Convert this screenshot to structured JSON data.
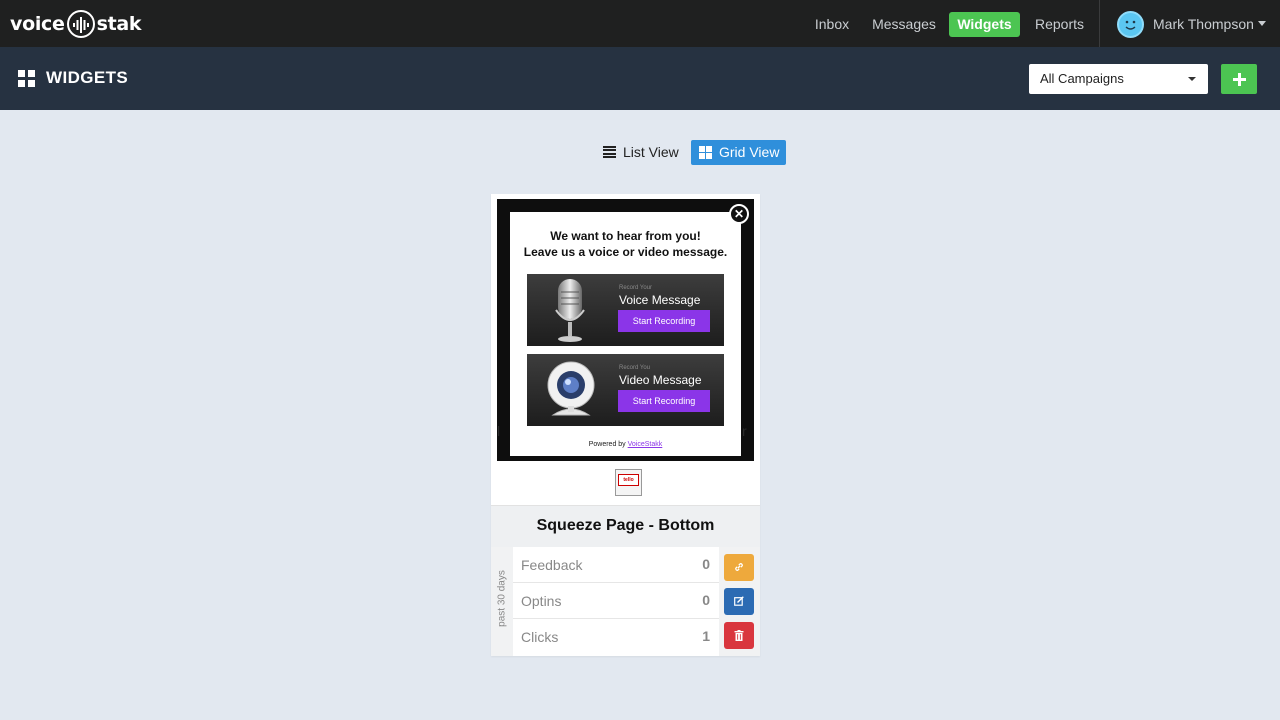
{
  "app": {
    "logo_left": "voice",
    "logo_right": "stak"
  },
  "nav": {
    "items": [
      {
        "label": "Inbox"
      },
      {
        "label": "Messages"
      },
      {
        "label": "Widgets",
        "active": true
      },
      {
        "label": "Reports"
      }
    ],
    "user_name": "Mark Thompson"
  },
  "header": {
    "title": "WIDGETS",
    "campaign_select": "All Campaigns"
  },
  "views": {
    "list_label": "List View",
    "grid_label": "Grid View",
    "active": "Grid View"
  },
  "widget": {
    "preview": {
      "heading_line1": "We want to hear from you!",
      "heading_line2": "Leave us a voice or video message.",
      "voice_small": "Record Your",
      "voice_title": "Voice Message",
      "voice_button": "Start Recording",
      "video_small": "Record You",
      "video_title": "Video Message",
      "video_button": "Start Recording",
      "powered_prefix": "Powered by ",
      "powered_brand": "VoiceStakk"
    },
    "logo_text": "tello",
    "name": "Squeeze Page - Bottom",
    "period_label": "past 30 days",
    "stats": [
      {
        "label": "Feedback",
        "value": "0"
      },
      {
        "label": "Optins",
        "value": "0"
      },
      {
        "label": "Clicks",
        "value": "1"
      }
    ]
  },
  "colors": {
    "nav_bg": "#1f2020",
    "header_bg": "#263241",
    "page_bg": "#e2e8f0",
    "active_green": "#4cc552",
    "grid_view_blue": "#2f8fdb",
    "link_orange": "#eea93c",
    "edit_blue": "#2c6bb3",
    "delete_red": "#d9363e",
    "record_purple": "#8b35e8"
  },
  "icons": [
    "voicestak-logo-icon",
    "grid-icon",
    "list-icon",
    "plus-icon",
    "caret-down-icon",
    "avatar-icon",
    "close-icon",
    "microphone-icon",
    "webcam-icon",
    "link-icon",
    "edit-icon",
    "trash-icon"
  ]
}
